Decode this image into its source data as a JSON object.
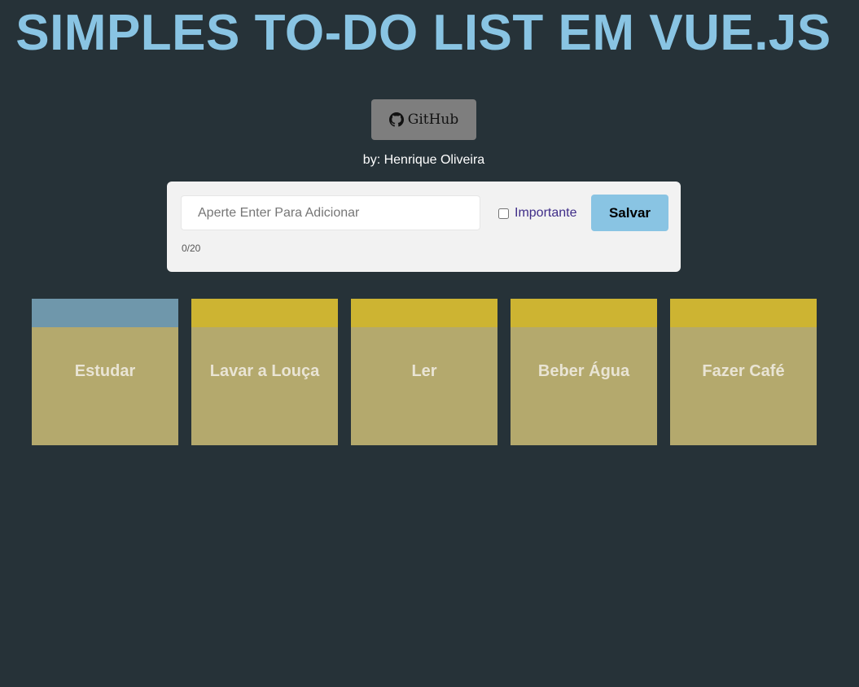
{
  "header": {
    "title": "SIMPLES TO-DO LIST EM VUE.JS",
    "github_label": "GitHub",
    "author": "by: Henrique Oliveira"
  },
  "form": {
    "input_placeholder": "Aperte Enter Para Adicionar",
    "input_value": "",
    "important_label": "Importante",
    "important_checked": false,
    "save_label": "Salvar",
    "counter": "0/20"
  },
  "colors": {
    "background": "#263238",
    "title": "#89c4e3",
    "card_body": "#b4a96d",
    "band_normal": "#6f97ab",
    "band_important": "#cdb432"
  },
  "tasks": [
    {
      "title": "Estudar",
      "important": false
    },
    {
      "title": "Lavar a Louça",
      "important": true
    },
    {
      "title": "Ler",
      "important": true
    },
    {
      "title": "Beber Água",
      "important": true
    },
    {
      "title": "Fazer Café",
      "important": true
    }
  ]
}
